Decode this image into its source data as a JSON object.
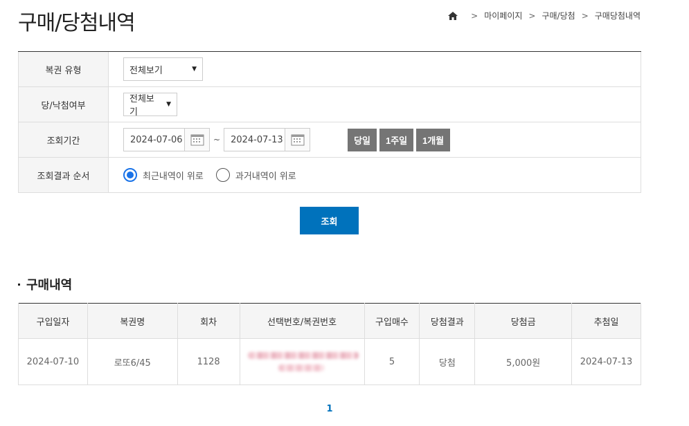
{
  "page": {
    "title": "구매/당첨내역"
  },
  "breadcrumb": {
    "items": [
      "마이페이지",
      "구매/당첨",
      "구매당첨내역"
    ]
  },
  "filters": {
    "lottery_type": {
      "label": "복권 유형",
      "value": "전체보기"
    },
    "win_status": {
      "label": "당/낙첨여부",
      "value": "전체보기"
    },
    "period": {
      "label": "조회기간",
      "start": "2024-07-06",
      "end": "2024-07-13",
      "separator": "~",
      "buttons": [
        "당일",
        "1주일",
        "1개월"
      ]
    },
    "order": {
      "label": "조회결과 순서",
      "options": [
        "최근내역이 위로",
        "과거내역이 위로"
      ],
      "selected_index": 0
    }
  },
  "search_button": "조회",
  "purchase": {
    "section_title": "구매내역",
    "headers": [
      "구입일자",
      "복권명",
      "회차",
      "선택번호/복권번호",
      "구입매수",
      "당첨결과",
      "당첨금",
      "추첨일"
    ],
    "rows": [
      {
        "date": "2024-07-10",
        "name": "로또6/45",
        "round": "1128",
        "count": "5",
        "result": "당첨",
        "prize": "5,000원",
        "draw_date": "2024-07-13"
      }
    ]
  },
  "pagination": {
    "current": "1"
  },
  "colors": {
    "accent": "#0072bc",
    "period_button": "#757575",
    "radio_checked": "#1a73e8"
  }
}
